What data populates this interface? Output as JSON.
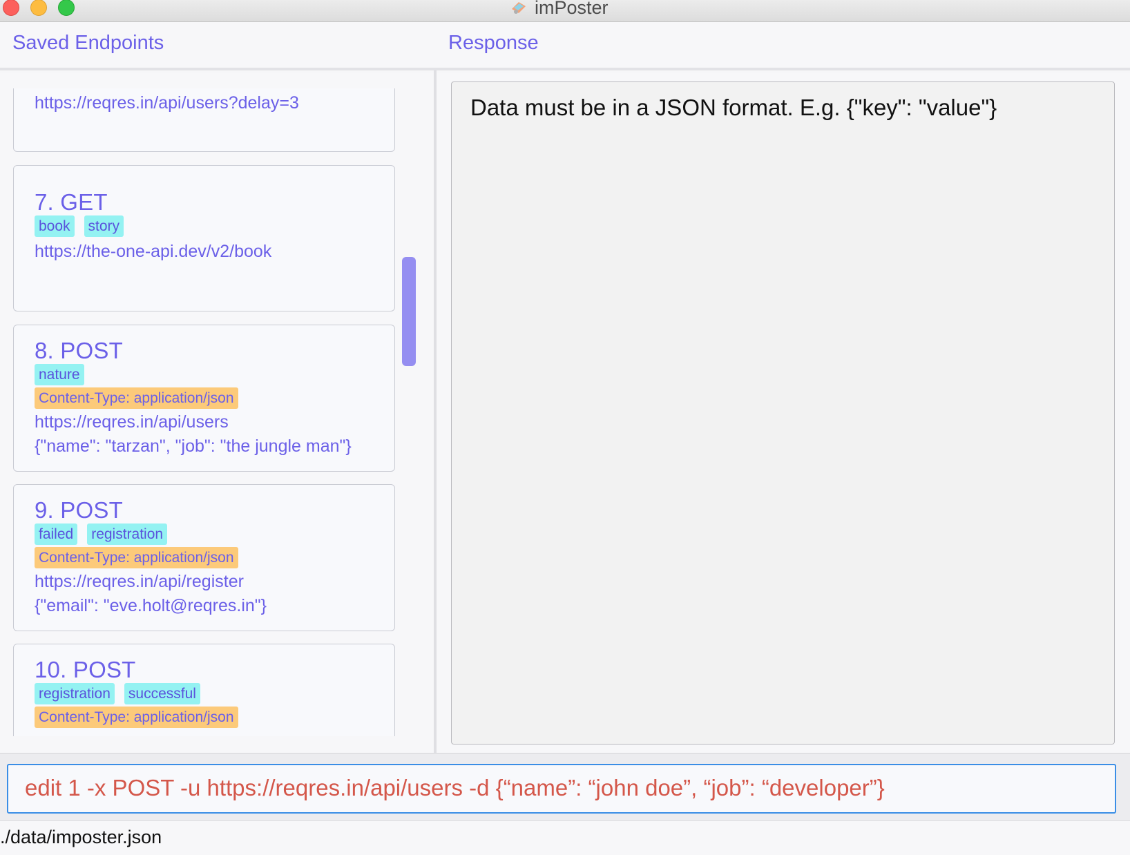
{
  "window": {
    "title": "imPoster",
    "controls": [
      "close",
      "minimize",
      "maximize"
    ],
    "app_icon": "imposter-logo-icon"
  },
  "headers": {
    "left": "Saved Endpoints",
    "right": "Response"
  },
  "endpoints": [
    {
      "url": "https://reqres.in/api/users?delay=3"
    },
    {
      "index": "7.",
      "method": "GET",
      "tags": [
        "book",
        "story"
      ],
      "url": "https://the-one-api.dev/v2/book"
    },
    {
      "index": "8.",
      "method": "POST",
      "tags": [
        "nature"
      ],
      "header": "Content-Type: application/json",
      "url": "https://reqres.in/api/users",
      "body": "{\"name\": \"tarzan\", \"job\": \"the jungle man\"}"
    },
    {
      "index": "9.",
      "method": "POST",
      "tags": [
        "failed",
        "registration"
      ],
      "header": "Content-Type: application/json",
      "url": "https://reqres.in/api/register",
      "body": "{\"email\": \"eve.holt@reqres.in\"}"
    },
    {
      "index": "10.",
      "method": "POST",
      "tags": [
        "registration",
        "successful"
      ],
      "header": "Content-Type: application/json"
    }
  ],
  "response": {
    "message": "Data must be in a JSON format. E.g. {\"key\": \"value\"}"
  },
  "command": {
    "value": "edit 1 -x POST -u https://reqres.in/api/users -d {“name”: “john doe”, “job”: “developer”}"
  },
  "status": {
    "path": "./data/imposter.json"
  },
  "colors": {
    "accent": "#6b60e8",
    "tag_bg": "#94f2f2",
    "header_tag_bg": "#fcca7a",
    "command_text": "#d4574a",
    "command_border": "#3a8ee6",
    "scrollbar": "#958ef1"
  }
}
